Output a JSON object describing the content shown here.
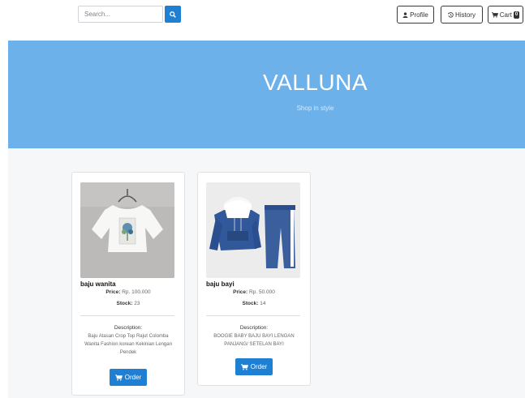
{
  "header": {
    "search": {
      "placeholder": "Search..."
    },
    "profile_label": "Profile",
    "history_label": "History",
    "cart_label": "Cart",
    "cart_count": "0"
  },
  "hero": {
    "title": "VALLUNA",
    "subtitle": "Shop in style"
  },
  "products": [
    {
      "name": "baju wanita",
      "price_label": "Price:",
      "price": "Rp. 100.000",
      "stock_label": "Stock:",
      "stock": "23",
      "description_label": "Description:",
      "description": "Baju Atasan Crop Top Rajut Colomba Wanita Fashion korean Kekinian Lengan Pendek",
      "order_label": "Order"
    },
    {
      "name": "baju bayi",
      "price_label": "Price:",
      "price": "Rp. 50.000",
      "stock_label": "Stock:",
      "stock": "14",
      "description_label": "Description:",
      "description": "BOOGIE BABY BAJU BAYI LENGAN PANJANG/ SETELAN BAYI",
      "order_label": "Order"
    }
  ],
  "colors": {
    "accent": "#1f7fd3",
    "hero": "#6db1ea",
    "background": "#f6f7f8"
  },
  "icons": [
    "search-icon",
    "user-icon",
    "history-icon",
    "cart-icon"
  ]
}
